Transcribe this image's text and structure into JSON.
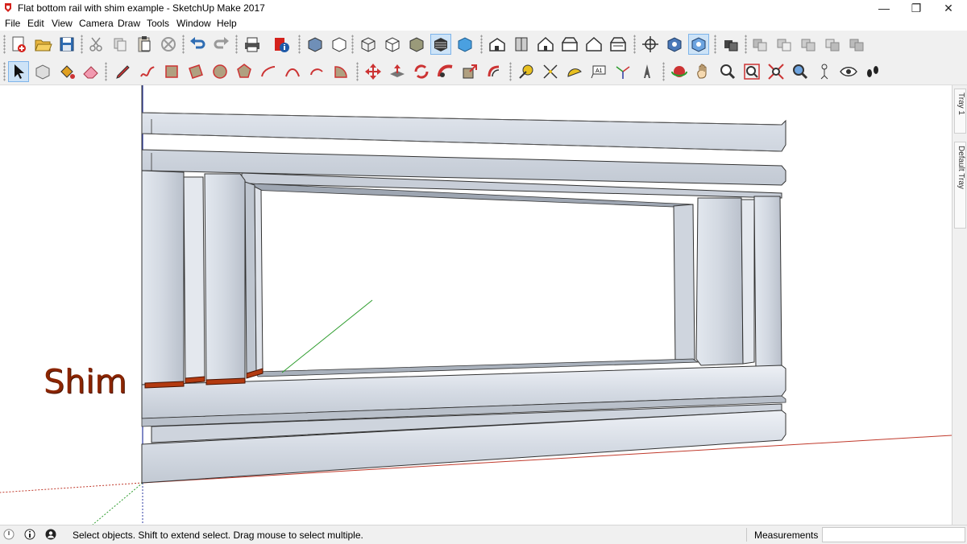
{
  "window": {
    "title": "Flat bottom rail with shim example - SketchUp Make 2017",
    "minimize_glyph": "—",
    "restore_glyph": "❐",
    "close_glyph": "✕"
  },
  "menu": [
    "File",
    "Edit",
    "View",
    "Camera",
    "Draw",
    "Tools",
    "Window",
    "Help"
  ],
  "toolbar1_icons": [
    "new-file",
    "open-file",
    "save-file",
    "cut",
    "copy",
    "paste",
    "erase",
    "undo",
    "redo",
    "print",
    "model-info",
    "xray-style",
    "wireframe-style",
    "hidden-line-style",
    "shaded-style",
    "shaded-textures-style",
    "monochrome-style",
    "iso-view",
    "top-view",
    "front-view",
    "right-view",
    "back-view",
    "left-view",
    "orbit-section",
    "section-plane",
    "display-section-planes",
    "components",
    "outer-shell",
    "intersect",
    "union",
    "subtract",
    "trim"
  ],
  "toolbar2_icons": [
    "select",
    "make-component",
    "paint-bucket",
    "eraser",
    "line",
    "freehand",
    "rectangle",
    "rotated-rectangle",
    "circle",
    "polygon",
    "arc",
    "two-point-arc",
    "three-point-arc",
    "pie",
    "move",
    "push-pull",
    "rotate",
    "follow-me",
    "scale",
    "offset",
    "tape-measure",
    "dimension",
    "protractor",
    "text",
    "axes",
    "3d-text",
    "orbit",
    "pan",
    "zoom",
    "zoom-window",
    "zoom-extents",
    "previous-view",
    "position-camera",
    "look-around",
    "walk"
  ],
  "viewport": {
    "annotation": "Shim",
    "accent_colors": {
      "shim": "#b33a10",
      "red_axis": "#c0392b",
      "green_axis": "#2e9d2e",
      "blue_axis": "#2b3aa0",
      "material": "#d8dde6"
    }
  },
  "tray": {
    "tabs": [
      "Tray 1",
      "Default Tray"
    ]
  },
  "status": {
    "message": "Select objects. Shift to extend select. Drag mouse to select multiple.",
    "measurements_label": "Measurements",
    "measurements_value": ""
  }
}
